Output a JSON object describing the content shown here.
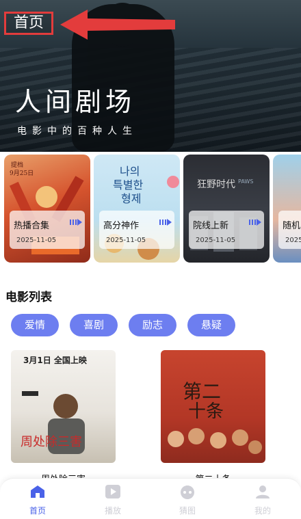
{
  "hero": {
    "title": "人间剧场",
    "subtitle": "电影中的百种人生"
  },
  "page_label": "首页",
  "cards": [
    {
      "name": "热播合集",
      "date": "2025-11-05"
    },
    {
      "name": "高分神作",
      "date": "2025-11-05"
    },
    {
      "name": "院线上新",
      "date": "2025-11-05"
    },
    {
      "name": "随机",
      "date": "2025"
    }
  ],
  "section": {
    "title": "电影列表"
  },
  "tags": [
    "爱情",
    "喜剧",
    "励志",
    "悬疑"
  ],
  "movies": [
    {
      "title": "周处除三害",
      "poster_top": "3月1日 全国上映"
    },
    {
      "title": "第二十条",
      "poster_top": ""
    }
  ],
  "nav": [
    {
      "label": "首页",
      "icon": "home-icon",
      "active": true
    },
    {
      "label": "播放",
      "icon": "play-icon",
      "active": false
    },
    {
      "label": "猜图",
      "icon": "game-icon",
      "active": false
    },
    {
      "label": "我的",
      "icon": "user-icon",
      "active": false
    }
  ],
  "colors": {
    "accent": "#6d7ef0",
    "nav_active": "#4a62e8",
    "nav_inactive": "#cfcfd6",
    "highlight": "#e33c3c"
  }
}
